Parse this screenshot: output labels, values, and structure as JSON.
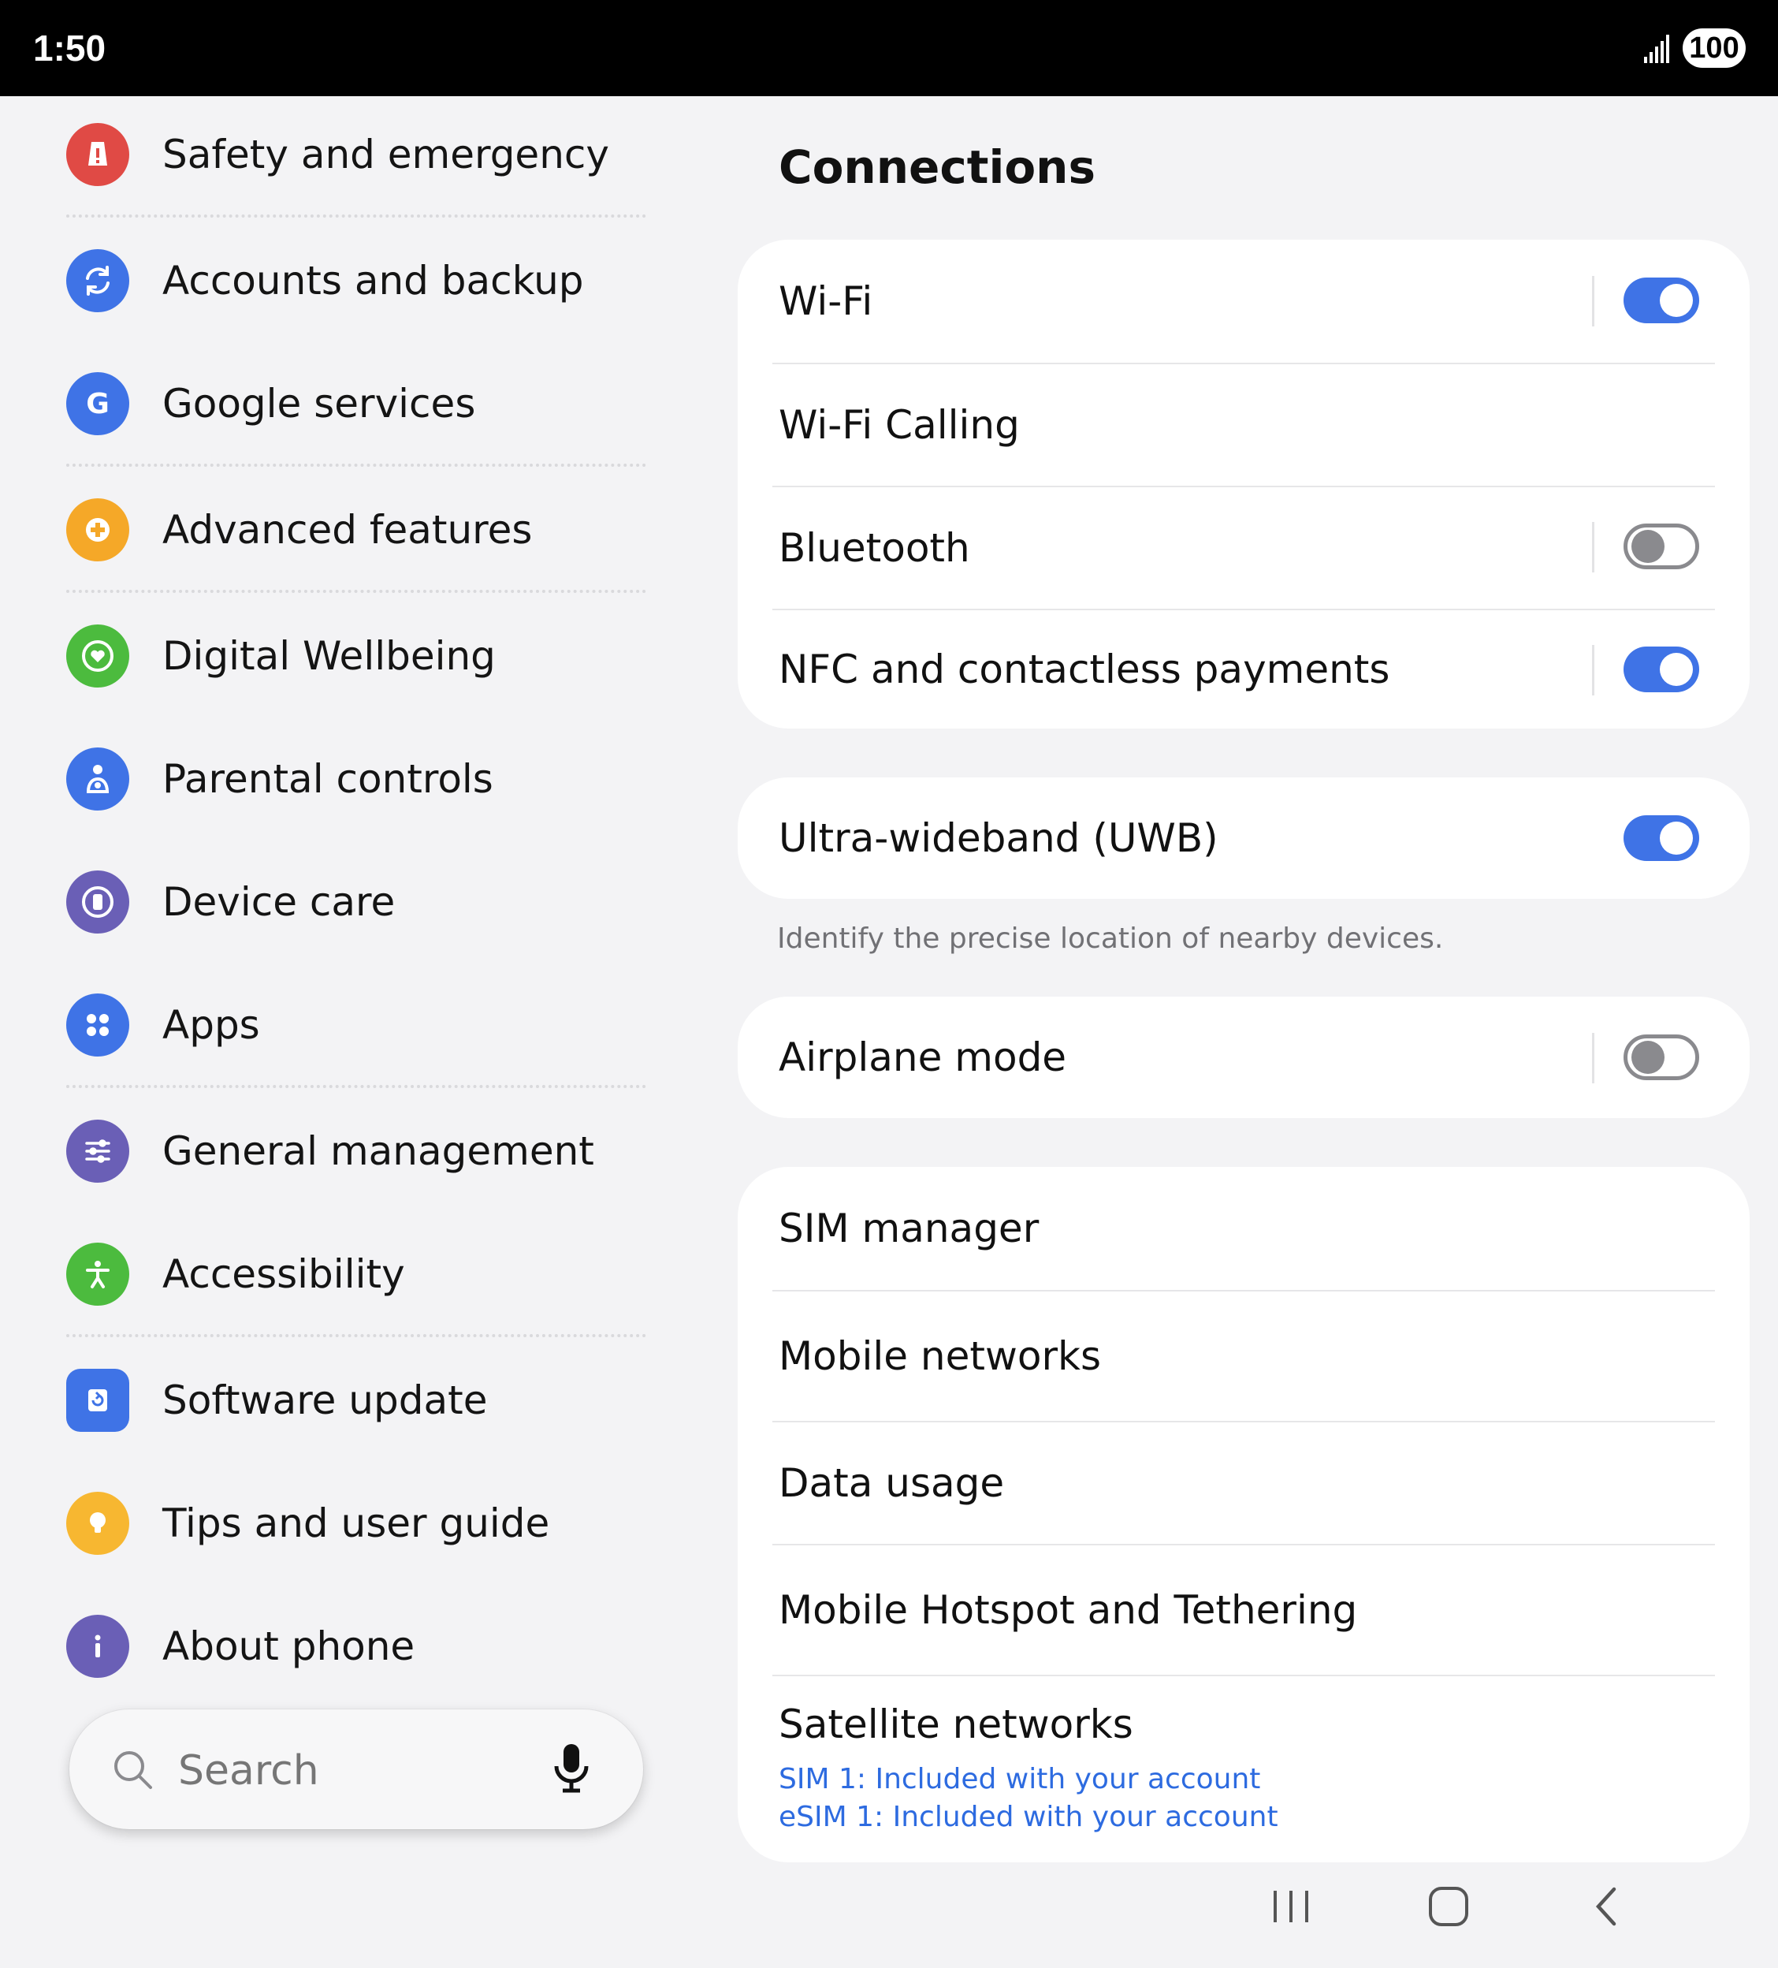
{
  "status_bar": {
    "time": "1:50",
    "battery": "100"
  },
  "menu": {
    "items": [
      {
        "label": "Safety and emergency",
        "icon": "alert-icon",
        "color": "#e04a45"
      },
      {
        "label": "Accounts and backup",
        "icon": "sync-icon",
        "color": "#3f73e6"
      },
      {
        "label": "Google services",
        "icon": "google-icon",
        "color": "#3f73e6"
      },
      {
        "label": "Advanced features",
        "icon": "plus-gear-icon",
        "color": "#f5a828"
      },
      {
        "label": "Digital Wellbeing",
        "icon": "heart-icon",
        "color": "#4cbb3e"
      },
      {
        "label": "Parental controls",
        "icon": "family-icon",
        "color": "#3f73e6"
      },
      {
        "label": "Device care",
        "icon": "device-care-icon",
        "color": "#6a5fb6"
      },
      {
        "label": "Apps",
        "icon": "apps-icon",
        "color": "#3f73e6"
      },
      {
        "label": "General management",
        "icon": "sliders-icon",
        "color": "#6a5fb6"
      },
      {
        "label": "Accessibility",
        "icon": "accessibility-icon",
        "color": "#4cbb3e"
      },
      {
        "label": "Software update",
        "icon": "update-icon",
        "color": "#3f73e6"
      },
      {
        "label": "Tips and user guide",
        "icon": "bulb-icon",
        "color": "#f7b731"
      },
      {
        "label": "About phone",
        "icon": "info-icon",
        "color": "#6a5fb6"
      }
    ]
  },
  "search": {
    "placeholder": "Search"
  },
  "main": {
    "title": "Connections",
    "group1": [
      {
        "label": "Wi-Fi",
        "toggle": "on"
      },
      {
        "label": "Wi-Fi Calling"
      },
      {
        "label": "Bluetooth",
        "toggle": "off"
      },
      {
        "label": "NFC and contactless payments",
        "toggle": "on"
      }
    ],
    "uwb": {
      "label": "Ultra-wideband (UWB)",
      "toggle": "on",
      "note": "Identify the precise location of nearby devices."
    },
    "airplane": {
      "label": "Airplane mode",
      "toggle": "off"
    },
    "group3": [
      {
        "label": "SIM manager"
      },
      {
        "label": "Mobile networks"
      },
      {
        "label": "Data usage"
      },
      {
        "label": "Mobile Hotspot and Tethering"
      },
      {
        "label": "Satellite networks",
        "sub1": "SIM 1: Included with your account",
        "sub2": "eSIM 1: Included with your account"
      }
    ]
  },
  "colors": {
    "accent": "#3f73e6",
    "link": "#2d6be0"
  }
}
